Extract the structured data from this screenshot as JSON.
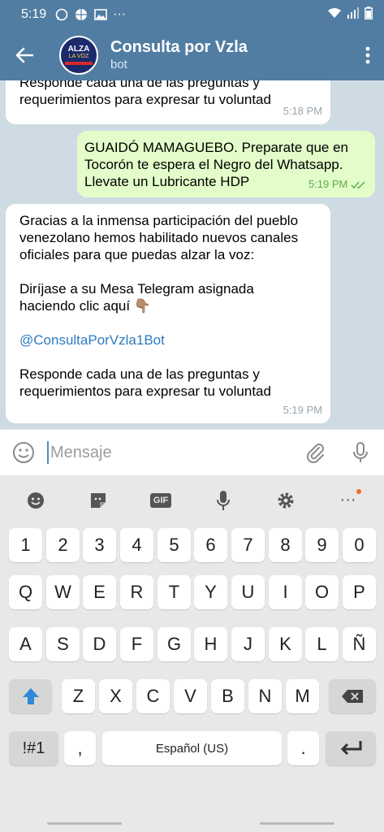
{
  "status_bar": {
    "time": "5:19",
    "overflow": "···",
    "icons": [
      "whatsapp-icon",
      "basketball-icon",
      "image-icon",
      "wifi-icon",
      "signal-icon",
      "battery-icon"
    ]
  },
  "header": {
    "title": "Consulta por Vzla",
    "subtitle": "bot",
    "avatar_text_1": "ALZA",
    "avatar_text_2": "LA VOZ"
  },
  "messages": [
    {
      "type": "incoming",
      "lines": [
        "Responde cada una de las preguntas y",
        "requerimientos para expresar tu voluntad"
      ],
      "time": "5:18 PM"
    },
    {
      "type": "outgoing",
      "lines": [
        "GUAIDÓ MAMAGUEBO. Preparate que en",
        "Tocorón te espera el Negro del Whatsapp.",
        "Llevate un Lubricante HDP"
      ],
      "time": "5:19 PM",
      "status": "read"
    },
    {
      "type": "incoming",
      "lines": [
        "Gracias a la inmensa participación del pueblo",
        "venezolano hemos habilitado nuevos canales",
        "oficiales  para que puedas alzar la voz:",
        "Diríjase a su Mesa Telegram asignada",
        "haciendo clic aquí 👇🏽",
        "@ConsultaPorVzla1Bot",
        "Responde cada una de las preguntas y",
        "requerimientos para expresar tu voluntad"
      ],
      "time": "5:19 PM"
    }
  ],
  "input": {
    "placeholder": "Mensaje"
  },
  "keyboard": {
    "toolbar": [
      "emoji-icon",
      "sticker-icon",
      "GIF",
      "mic-icon",
      "settings-icon",
      "···"
    ],
    "numbers": [
      "1",
      "2",
      "3",
      "4",
      "5",
      "6",
      "7",
      "8",
      "9",
      "0"
    ],
    "row1": [
      "Q",
      "W",
      "E",
      "R",
      "T",
      "Y",
      "U",
      "I",
      "O",
      "P"
    ],
    "row2": [
      "A",
      "S",
      "D",
      "F",
      "G",
      "H",
      "J",
      "K",
      "L",
      "Ñ"
    ],
    "row3": [
      "Z",
      "X",
      "C",
      "V",
      "B",
      "N",
      "M"
    ],
    "symbols": "!#1",
    "comma": ",",
    "space": "Español (US)",
    "period": "."
  },
  "colors": {
    "header": "#527da3",
    "outgoing_bubble": "#e2fdc9",
    "link": "#2f7bbf"
  }
}
